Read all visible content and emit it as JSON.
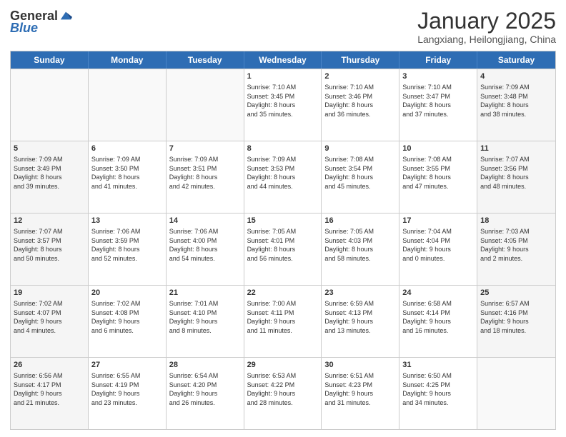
{
  "header": {
    "logo_general": "General",
    "logo_blue": "Blue",
    "month_title": "January 2025",
    "location": "Langxiang, Heilongjiang, China"
  },
  "weekdays": [
    "Sunday",
    "Monday",
    "Tuesday",
    "Wednesday",
    "Thursday",
    "Friday",
    "Saturday"
  ],
  "rows": [
    [
      {
        "day": "",
        "text": "",
        "empty": true
      },
      {
        "day": "",
        "text": "",
        "empty": true
      },
      {
        "day": "",
        "text": "",
        "empty": true
      },
      {
        "day": "1",
        "text": "Sunrise: 7:10 AM\nSunset: 3:45 PM\nDaylight: 8 hours\nand 35 minutes.",
        "empty": false
      },
      {
        "day": "2",
        "text": "Sunrise: 7:10 AM\nSunset: 3:46 PM\nDaylight: 8 hours\nand 36 minutes.",
        "empty": false
      },
      {
        "day": "3",
        "text": "Sunrise: 7:10 AM\nSunset: 3:47 PM\nDaylight: 8 hours\nand 37 minutes.",
        "empty": false
      },
      {
        "day": "4",
        "text": "Sunrise: 7:09 AM\nSunset: 3:48 PM\nDaylight: 8 hours\nand 38 minutes.",
        "empty": false,
        "shaded": true
      }
    ],
    [
      {
        "day": "5",
        "text": "Sunrise: 7:09 AM\nSunset: 3:49 PM\nDaylight: 8 hours\nand 39 minutes.",
        "empty": false,
        "shaded": true
      },
      {
        "day": "6",
        "text": "Sunrise: 7:09 AM\nSunset: 3:50 PM\nDaylight: 8 hours\nand 41 minutes.",
        "empty": false
      },
      {
        "day": "7",
        "text": "Sunrise: 7:09 AM\nSunset: 3:51 PM\nDaylight: 8 hours\nand 42 minutes.",
        "empty": false
      },
      {
        "day": "8",
        "text": "Sunrise: 7:09 AM\nSunset: 3:53 PM\nDaylight: 8 hours\nand 44 minutes.",
        "empty": false
      },
      {
        "day": "9",
        "text": "Sunrise: 7:08 AM\nSunset: 3:54 PM\nDaylight: 8 hours\nand 45 minutes.",
        "empty": false
      },
      {
        "day": "10",
        "text": "Sunrise: 7:08 AM\nSunset: 3:55 PM\nDaylight: 8 hours\nand 47 minutes.",
        "empty": false
      },
      {
        "day": "11",
        "text": "Sunrise: 7:07 AM\nSunset: 3:56 PM\nDaylight: 8 hours\nand 48 minutes.",
        "empty": false,
        "shaded": true
      }
    ],
    [
      {
        "day": "12",
        "text": "Sunrise: 7:07 AM\nSunset: 3:57 PM\nDaylight: 8 hours\nand 50 minutes.",
        "empty": false,
        "shaded": true
      },
      {
        "day": "13",
        "text": "Sunrise: 7:06 AM\nSunset: 3:59 PM\nDaylight: 8 hours\nand 52 minutes.",
        "empty": false
      },
      {
        "day": "14",
        "text": "Sunrise: 7:06 AM\nSunset: 4:00 PM\nDaylight: 8 hours\nand 54 minutes.",
        "empty": false
      },
      {
        "day": "15",
        "text": "Sunrise: 7:05 AM\nSunset: 4:01 PM\nDaylight: 8 hours\nand 56 minutes.",
        "empty": false
      },
      {
        "day": "16",
        "text": "Sunrise: 7:05 AM\nSunset: 4:03 PM\nDaylight: 8 hours\nand 58 minutes.",
        "empty": false
      },
      {
        "day": "17",
        "text": "Sunrise: 7:04 AM\nSunset: 4:04 PM\nDaylight: 9 hours\nand 0 minutes.",
        "empty": false
      },
      {
        "day": "18",
        "text": "Sunrise: 7:03 AM\nSunset: 4:05 PM\nDaylight: 9 hours\nand 2 minutes.",
        "empty": false,
        "shaded": true
      }
    ],
    [
      {
        "day": "19",
        "text": "Sunrise: 7:02 AM\nSunset: 4:07 PM\nDaylight: 9 hours\nand 4 minutes.",
        "empty": false,
        "shaded": true
      },
      {
        "day": "20",
        "text": "Sunrise: 7:02 AM\nSunset: 4:08 PM\nDaylight: 9 hours\nand 6 minutes.",
        "empty": false
      },
      {
        "day": "21",
        "text": "Sunrise: 7:01 AM\nSunset: 4:10 PM\nDaylight: 9 hours\nand 8 minutes.",
        "empty": false
      },
      {
        "day": "22",
        "text": "Sunrise: 7:00 AM\nSunset: 4:11 PM\nDaylight: 9 hours\nand 11 minutes.",
        "empty": false
      },
      {
        "day": "23",
        "text": "Sunrise: 6:59 AM\nSunset: 4:13 PM\nDaylight: 9 hours\nand 13 minutes.",
        "empty": false
      },
      {
        "day": "24",
        "text": "Sunrise: 6:58 AM\nSunset: 4:14 PM\nDaylight: 9 hours\nand 16 minutes.",
        "empty": false
      },
      {
        "day": "25",
        "text": "Sunrise: 6:57 AM\nSunset: 4:16 PM\nDaylight: 9 hours\nand 18 minutes.",
        "empty": false,
        "shaded": true
      }
    ],
    [
      {
        "day": "26",
        "text": "Sunrise: 6:56 AM\nSunset: 4:17 PM\nDaylight: 9 hours\nand 21 minutes.",
        "empty": false,
        "shaded": true
      },
      {
        "day": "27",
        "text": "Sunrise: 6:55 AM\nSunset: 4:19 PM\nDaylight: 9 hours\nand 23 minutes.",
        "empty": false
      },
      {
        "day": "28",
        "text": "Sunrise: 6:54 AM\nSunset: 4:20 PM\nDaylight: 9 hours\nand 26 minutes.",
        "empty": false
      },
      {
        "day": "29",
        "text": "Sunrise: 6:53 AM\nSunset: 4:22 PM\nDaylight: 9 hours\nand 28 minutes.",
        "empty": false
      },
      {
        "day": "30",
        "text": "Sunrise: 6:51 AM\nSunset: 4:23 PM\nDaylight: 9 hours\nand 31 minutes.",
        "empty": false
      },
      {
        "day": "31",
        "text": "Sunrise: 6:50 AM\nSunset: 4:25 PM\nDaylight: 9 hours\nand 34 minutes.",
        "empty": false
      },
      {
        "day": "",
        "text": "",
        "empty": true,
        "shaded": true
      }
    ]
  ]
}
